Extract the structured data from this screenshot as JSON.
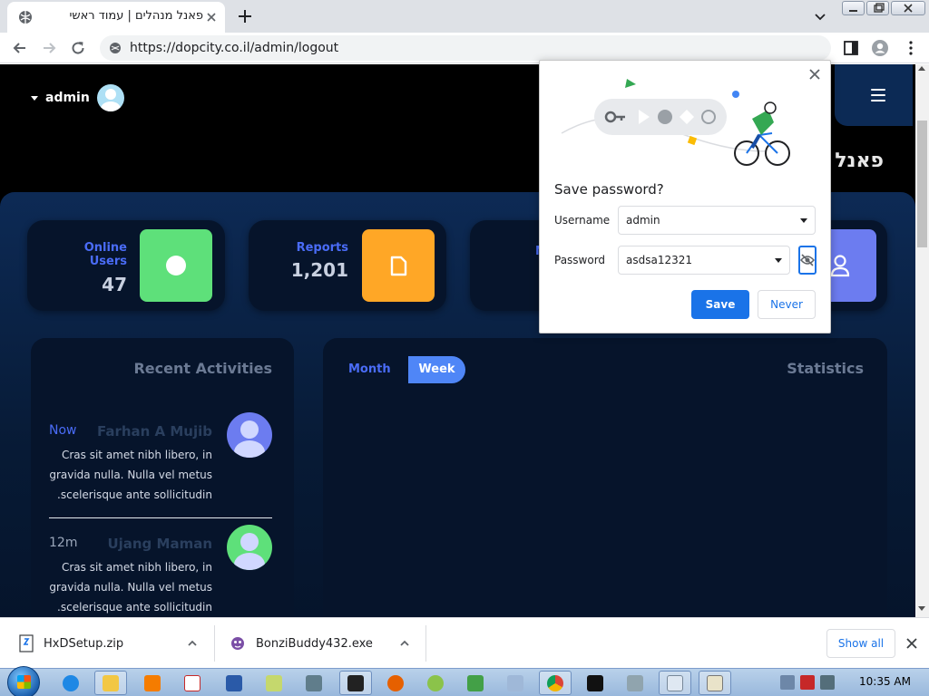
{
  "browser": {
    "tab_title": "פאנל מנהלים | עמוד ראשי",
    "url": "https://dopcity.co.il/admin/logout"
  },
  "page": {
    "admin_name": "admin",
    "title_partial": "פאנל",
    "cards": [
      {
        "label_line1": "Online",
        "label_line2": "Users",
        "value": "47",
        "icon_color": "#5ee07a",
        "icon": "circle-icon"
      },
      {
        "label_line1": "Reports",
        "label_line2": "",
        "value": "1,201",
        "icon_color": "#ffa726",
        "icon": "document-icon"
      },
      {
        "label_line1": "N",
        "label_line2": "",
        "value": "",
        "icon_color": "#6c7cf0",
        "icon": "user-icon"
      }
    ],
    "activities": {
      "title": "Recent Activities",
      "items": [
        {
          "time": "Now",
          "time_color": "#4a6cf7",
          "name": "Farhan A Mujib",
          "avatar_color": "#6c7cf0",
          "text": "Cras sit amet nibh libero, in gravida nulla. Nulla vel metus scelerisque ante sollicitudin."
        },
        {
          "time": "12m",
          "time_color": "#9aa6ba",
          "name": "Ujang Maman",
          "avatar_color": "#5ee07a",
          "text": "Cras sit amet nibh libero, in gravida nulla. Nulla vel metus scelerisque ante sollicitudin."
        }
      ]
    },
    "stats": {
      "title": "Statistics",
      "tab_month": "Month",
      "tab_week": "Week"
    }
  },
  "password_popup": {
    "title": "Save password?",
    "username_label": "Username",
    "username_value": "admin",
    "password_label": "Password",
    "password_value": "asdsa12321",
    "save_label": "Save",
    "never_label": "Never"
  },
  "downloads": {
    "items": [
      {
        "name": "HxDSetup.zip"
      },
      {
        "name": "BonziBuddy432.exe"
      }
    ],
    "show_all": "Show all"
  },
  "taskbar": {
    "clock": "10:35 AM",
    "apps": [
      "ie-icon",
      "explorer-icon",
      "media-player-icon",
      "solitaire-icon",
      "powershell-icon",
      "notepad-icon",
      "network-icon",
      "7zip-icon",
      "firefox-icon",
      "paint-icon",
      "generic-app-icon",
      "calculator-icon",
      "chrome-icon",
      "cmd-icon",
      "control-panel-icon",
      "notepad2-icon",
      "hex-editor-icon"
    ]
  },
  "colors": {
    "accent_blue": "#1a73e8",
    "card_green": "#5ee07a",
    "card_orange": "#ffa726",
    "card_purple": "#6c7cf0",
    "label_blue": "#4a6cf7"
  }
}
